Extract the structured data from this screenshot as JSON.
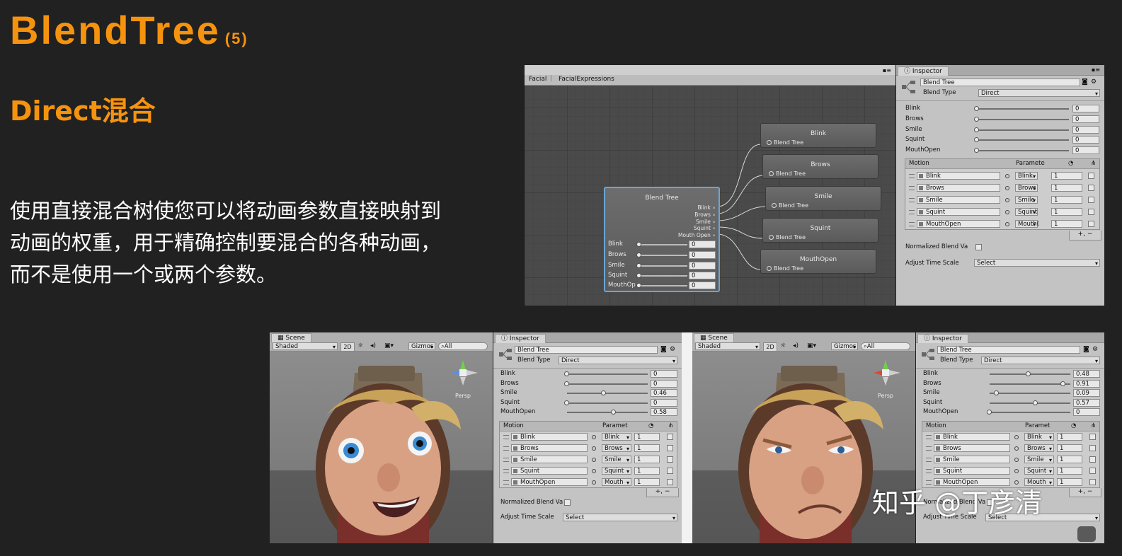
{
  "slide": {
    "title": "BlendTree",
    "title_num": "(5)",
    "subtitle": "Direct混合",
    "description_lines": [
      "使用直接混合树使您可以将动画参数直接映射到",
      "动画的权重，用于精确控制要混合的各种动画，",
      "而不是使用一个或两个参数。"
    ],
    "watermark_brand": "知乎 @丁彦清"
  },
  "colors": {
    "accent": "#f6930e",
    "background": "#212121",
    "unity_panel": "#c3c3c3"
  },
  "animator": {
    "breadcrumb": [
      "Facial",
      "FacialExpressions"
    ],
    "main_node": {
      "title": "Blend Tree",
      "outputs": [
        "Blink",
        "Brows",
        "Smile",
        "Squint",
        "Mouth Open"
      ],
      "params": [
        "Blink",
        "Brows",
        "Smile",
        "Squint",
        "MouthOp"
      ],
      "values": [
        "0",
        "0",
        "0",
        "0",
        "0"
      ]
    },
    "child_nodes": [
      {
        "title": "Blink",
        "sub": "Blend Tree"
      },
      {
        "title": "Brows",
        "sub": "Blend Tree"
      },
      {
        "title": "Smile",
        "sub": "Blend Tree"
      },
      {
        "title": "Squint",
        "sub": "Blend Tree"
      },
      {
        "title": "MouthOpen",
        "sub": "Blend Tree"
      }
    ]
  },
  "inspector_top": {
    "tab": "Inspector",
    "name": "Blend Tree",
    "blend_type_label": "Blend Type",
    "blend_type": "Direct",
    "params": [
      {
        "label": "Blink",
        "value": "0",
        "level": 0
      },
      {
        "label": "Brows",
        "value": "0",
        "level": 0
      },
      {
        "label": "Smile",
        "value": "0",
        "level": 0
      },
      {
        "label": "Squint",
        "value": "0",
        "level": 0
      },
      {
        "label": "MouthOpen",
        "value": "0",
        "level": 0
      }
    ],
    "list_headers": {
      "motion": "Motion",
      "param": "Paramete"
    },
    "rows": [
      {
        "motion": "Blink",
        "param": "Blink",
        "value": "1"
      },
      {
        "motion": "Brows",
        "param": "Brows",
        "value": "1"
      },
      {
        "motion": "Smile",
        "param": "Smile",
        "value": "1"
      },
      {
        "motion": "Squint",
        "param": "Squint",
        "value": "1"
      },
      {
        "motion": "MouthOpen",
        "param": "Mouth(",
        "value": "1"
      }
    ],
    "normalized_label": "Normalized Blend Va",
    "adjust_label": "Adjust Time Scale",
    "adjust_value": "Select"
  },
  "scene_left": {
    "tab": "Scene",
    "shading": "Shaded",
    "mode2d": "2D",
    "gizmos": "Gizmos",
    "search": "All",
    "persp": "Persp"
  },
  "inspector_left": {
    "tab": "Inspector",
    "name": "Blend Tree",
    "blend_type_label": "Blend Type",
    "blend_type": "Direct",
    "params": [
      {
        "label": "Blink",
        "value": "0",
        "level": 0
      },
      {
        "label": "Brows",
        "value": "0",
        "level": 0
      },
      {
        "label": "Smile",
        "value": "0.46",
        "level": 0.46
      },
      {
        "label": "Squint",
        "value": "0",
        "level": 0
      },
      {
        "label": "MouthOpen",
        "value": "0.58",
        "level": 0.58
      }
    ],
    "list_headers": {
      "motion": "Motion",
      "param": "Paramet"
    },
    "rows": [
      {
        "motion": "Blink",
        "param": "Blink",
        "value": "1"
      },
      {
        "motion": "Brows",
        "param": "Brows",
        "value": "1"
      },
      {
        "motion": "Smile",
        "param": "Smile",
        "value": "1"
      },
      {
        "motion": "Squint",
        "param": "Squint",
        "value": "1"
      },
      {
        "motion": "MouthOpen",
        "param": "Mouth",
        "value": "1"
      }
    ],
    "normalized_label": "Normalized Blend Va",
    "adjust_label": "Adjust Time Scale",
    "adjust_value": "Select"
  },
  "scene_right": {
    "tab": "Scene",
    "shading": "Shaded",
    "mode2d": "2D",
    "gizmos": "Gizmos",
    "search": "All",
    "persp": "Persp"
  },
  "inspector_right": {
    "tab": "Inspector",
    "name": "Blend Tree",
    "blend_type_label": "Blend Type",
    "blend_type": "Direct",
    "params": [
      {
        "label": "Blink",
        "value": "0.48",
        "level": 0.48
      },
      {
        "label": "Brows",
        "value": "0.91",
        "level": 0.91
      },
      {
        "label": "Smile",
        "value": "0.09",
        "level": 0.09
      },
      {
        "label": "Squint",
        "value": "0.57",
        "level": 0.57
      },
      {
        "label": "MouthOpen",
        "value": "0",
        "level": 0
      }
    ],
    "list_headers": {
      "motion": "Motion",
      "param": "Paramet"
    },
    "rows": [
      {
        "motion": "Blink",
        "param": "Blink",
        "value": "1"
      },
      {
        "motion": "Brows",
        "param": "Brows",
        "value": "1"
      },
      {
        "motion": "Smile",
        "param": "Smile",
        "value": "1"
      },
      {
        "motion": "Squint",
        "param": "Squint",
        "value": "1"
      },
      {
        "motion": "MouthOpen",
        "param": "Mouth",
        "value": "1"
      }
    ],
    "normalized_label": "Normalized Blend Va",
    "adjust_label": "Adjust Time Scale",
    "adjust_value": "Select"
  }
}
